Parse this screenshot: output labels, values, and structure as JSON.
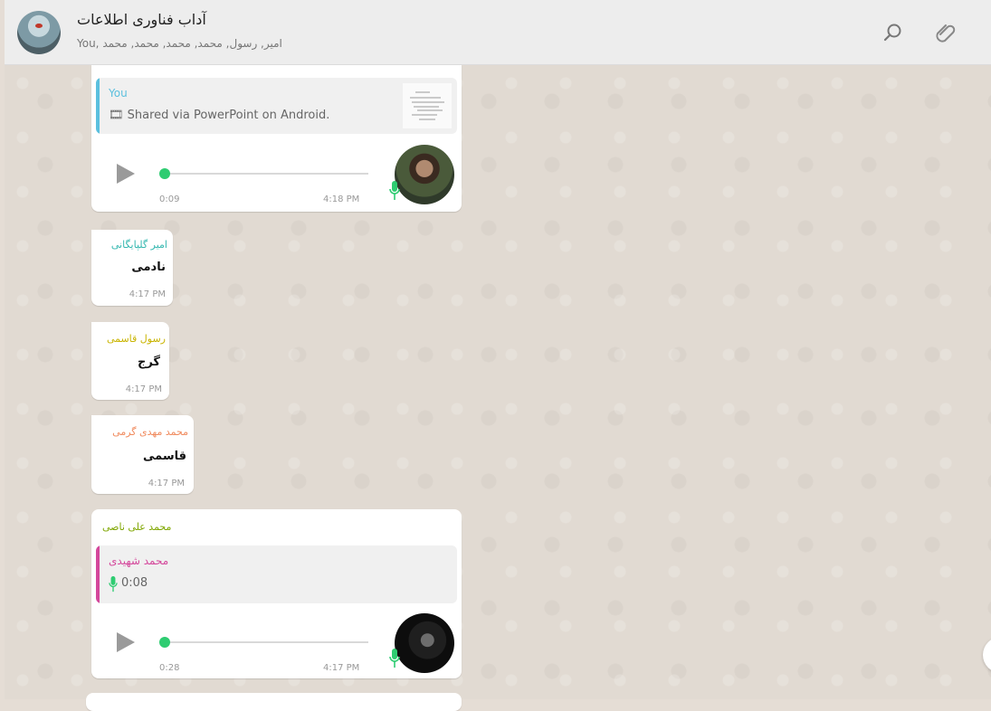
{
  "header": {
    "title": "آداب فناوری اطلاعات",
    "participants": "You, امیر, رسول, محمد, محمد, محمد, محمد"
  },
  "messages": [
    {
      "quote_author": "You",
      "quote_text": "🎞 Shared via PowerPoint on Android.",
      "duration": "0:09",
      "time": "4:18 PM"
    },
    {
      "sender": "امیر گلپایگانی",
      "text": "نادمی",
      "time": "4:17 PM"
    },
    {
      "sender": "رسول قاسمی",
      "text": "گرج",
      "time": "4:17 PM"
    },
    {
      "sender": "محمد مهدی گرمی",
      "text": "قاسمی",
      "time": "4:17 PM"
    },
    {
      "sender": "محمد علی ناصی",
      "quote_author": "محمد شهیدی",
      "quote_text": "0:08",
      "duration": "0:28",
      "time": "4:17 PM"
    }
  ],
  "colors": {
    "you": "#5bc0de",
    "sender1": "#35b8b0",
    "sender2": "#c9b400",
    "sender3": "#f08a5d",
    "sender4": "#7fa600",
    "quote4": "#d4479b",
    "accent": "#2ecc71"
  }
}
